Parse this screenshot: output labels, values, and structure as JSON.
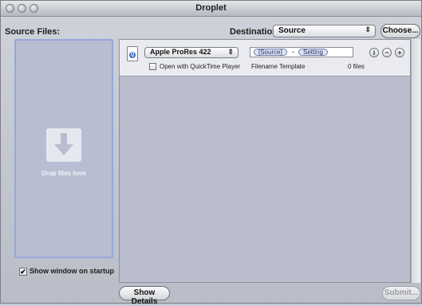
{
  "window": {
    "title": "Droplet"
  },
  "source": {
    "label": "Source Files:",
    "drop_label": "Drop files here"
  },
  "destination": {
    "label": "Destination:",
    "value": "Source",
    "choose_label": "Choose..."
  },
  "item": {
    "preset": "Apple ProRes 422",
    "tokens": [
      "[Source]",
      "Setting"
    ],
    "token_separator": "-",
    "open_with_label": "Open with QuickTime Player",
    "open_with_checked": false,
    "filename_label": "Filename Template",
    "file_count": "0 files",
    "info_icon": "i",
    "remove_icon": "−",
    "add_icon": "+"
  },
  "startup": {
    "label": "Show window on startup",
    "checked": true,
    "check_glyph": "✔"
  },
  "footer": {
    "details_label": "Show Details",
    "submit_label": "Submit..."
  }
}
